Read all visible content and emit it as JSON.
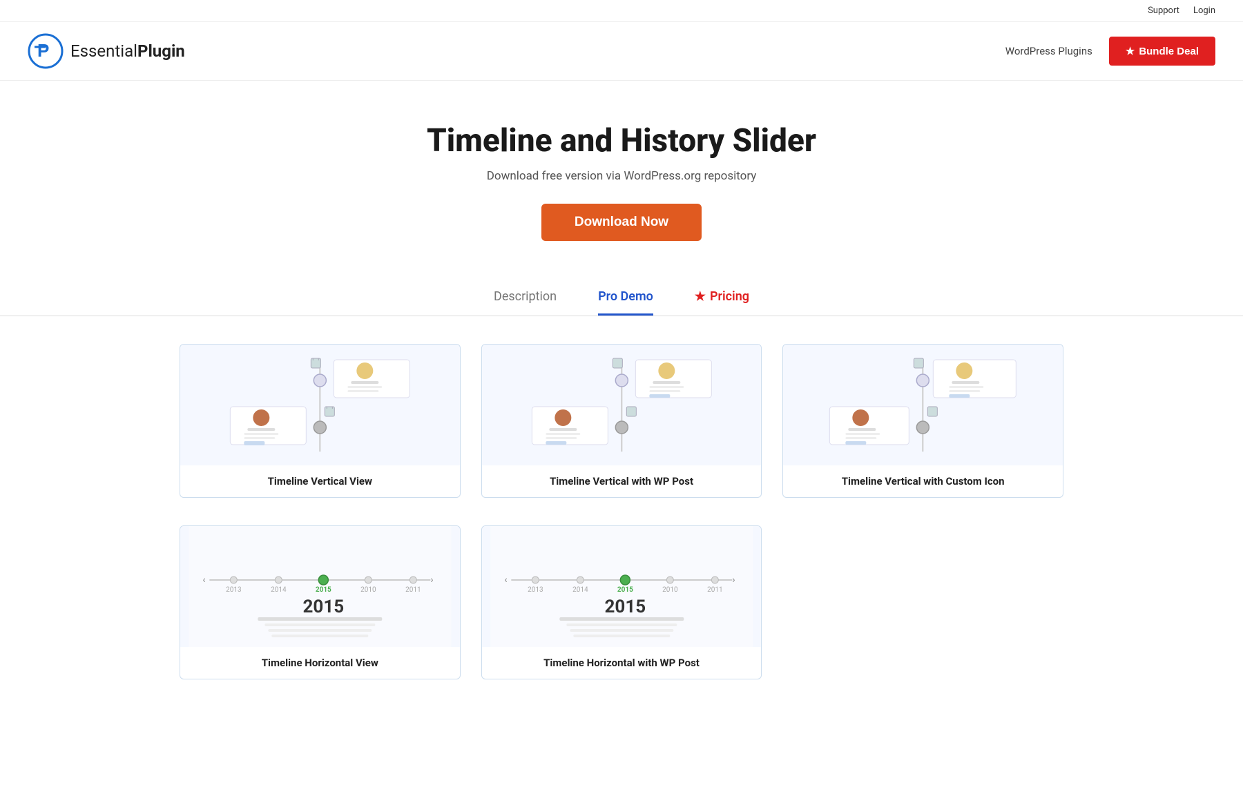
{
  "topbar": {
    "support_label": "Support",
    "login_label": "Login"
  },
  "header": {
    "logo_name": "EssentialPlugin",
    "logo_plain": "Essential",
    "logo_bold": "Plugin",
    "nav_label": "WordPress Plugins",
    "bundle_label": "Bundle Deal"
  },
  "hero": {
    "title": "Timeline and History Slider",
    "subtitle": "Download free version via WordPress.org repository",
    "download_label": "Download Now"
  },
  "tabs": [
    {
      "id": "description",
      "label": "Description",
      "active": false,
      "pricing": false
    },
    {
      "id": "pro-demo",
      "label": "Pro Demo",
      "active": true,
      "pricing": false
    },
    {
      "id": "pricing",
      "label": "Pricing",
      "active": false,
      "pricing": true
    }
  ],
  "demo_cards_top": [
    {
      "id": "vertical-view",
      "title": "Timeline Vertical View",
      "type": "vertical"
    },
    {
      "id": "vertical-wp-post",
      "title": "Timeline Vertical with WP Post",
      "type": "vertical"
    },
    {
      "id": "vertical-custom-icon",
      "title": "Timeline Vertical with Custom Icon",
      "type": "vertical"
    }
  ],
  "demo_cards_bottom": [
    {
      "id": "horizontal-view",
      "title": "Timeline Horizontal View",
      "type": "horizontal"
    },
    {
      "id": "horizontal-wp-post",
      "title": "Timeline Horizontal with WP Post",
      "type": "horizontal"
    }
  ],
  "colors": {
    "accent_blue": "#2255cc",
    "accent_red": "#e02020",
    "accent_orange": "#e05a20",
    "card_border": "#c8daf0"
  }
}
